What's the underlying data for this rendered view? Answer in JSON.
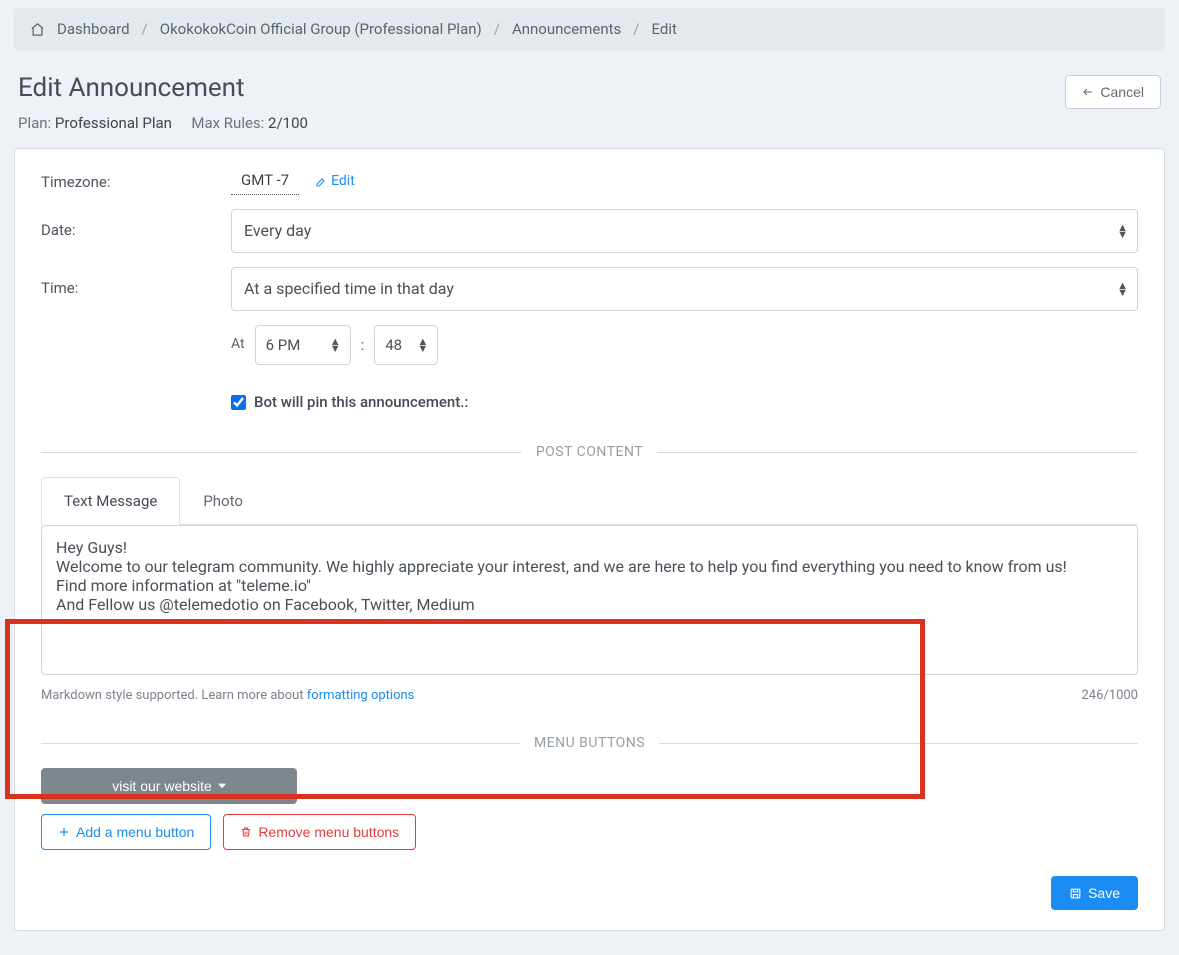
{
  "breadcrumbs": {
    "dashboard": "Dashboard",
    "group": "OkokokokCoin Official Group (Professional Plan)",
    "section": "Announcements",
    "current": "Edit"
  },
  "header": {
    "title": "Edit Announcement",
    "plan_label": "Plan: ",
    "plan_value": "Professional Plan",
    "max_rules_label": "Max Rules: ",
    "max_rules_value": "2/100",
    "cancel": "Cancel"
  },
  "fields": {
    "timezone_label": "Timezone:",
    "timezone_value": "GMT -7",
    "timezone_edit": "Edit",
    "date_label": "Date:",
    "date_value": "Every day",
    "time_label": "Time:",
    "time_mode": "At a specified time in that day",
    "at_label": "At",
    "hour_value": "6 PM",
    "minute_value": "48",
    "pin_label": "Bot will pin this announcement.:"
  },
  "post": {
    "section_title": "POST CONTENT",
    "tab_text": "Text Message",
    "tab_photo": "Photo",
    "textarea_value": "Hey Guys!\nWelcome to our telegram community. We highly appreciate your interest, and we are here to help you find everything you need to know from us!\nFind more information at \"teleme.io\"\nAnd Fellow us @telemedotio on Facebook, Twitter, Medium",
    "helper_prefix": "Markdown style supported. Learn more about ",
    "helper_link": "formatting options",
    "counter": "246/1000"
  },
  "menu": {
    "section_title": "MENU BUTTONS",
    "chip": "visit our website",
    "add": "Add a menu button",
    "remove": "Remove menu buttons"
  },
  "actions": {
    "save": "Save"
  }
}
